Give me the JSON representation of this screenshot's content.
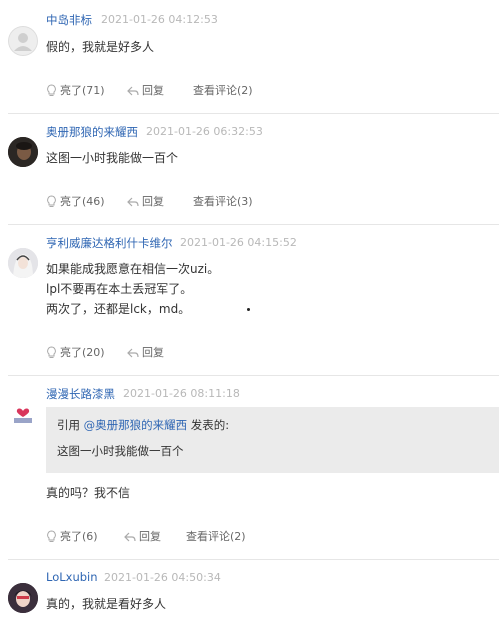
{
  "comments": [
    {
      "username": "中岛非标",
      "time": "2021-01-26 04:12:53",
      "lines": [
        "假的，我就是好多人"
      ],
      "like_label": "亮了(71)",
      "reply_label": "回复",
      "view_label": "查看评论(2)"
    },
    {
      "username": "奥册那狼的来耀西",
      "time": "2021-01-26 06:32:53",
      "lines": [
        "这图一小时我能做一百个"
      ],
      "like_label": "亮了(46)",
      "reply_label": "回复",
      "view_label": "查看评论(3)"
    },
    {
      "username": "亨利威廉达格利什卡维尔",
      "time": "2021-01-26 04:15:52",
      "lines": [
        "如果能成我愿意在相信一次uzi。",
        "lpl不要再在本土丢冠军了。",
        "两次了，还都是lck，md。"
      ],
      "like_label": "亮了(20)",
      "reply_label": "回复"
    },
    {
      "username": "漫漫长路漆黑",
      "time": "2021-01-26 08:11:18",
      "quote": {
        "prefix": "引用 ",
        "user": "@奥册那狼的来耀西",
        "suffix": " 发表的:",
        "text": "这图一小时我能做一百个"
      },
      "lines": [
        "真的吗？我不信"
      ],
      "like_label": "亮了(6)",
      "reply_label": "回复",
      "view_label": "查看评论(2)"
    },
    {
      "username": "LoLxubin",
      "time": "2021-01-26 04:50:34",
      "lines": [
        "真的，我就是看好多人"
      ]
    }
  ],
  "colors": {
    "username": "#2f66b3",
    "time": "#b8b8b8",
    "quote_bg": "#ebebeb",
    "divider": "#e6e6e6"
  },
  "icons": {
    "like": "bulb-icon",
    "reply": "reply-arrow-icon"
  }
}
